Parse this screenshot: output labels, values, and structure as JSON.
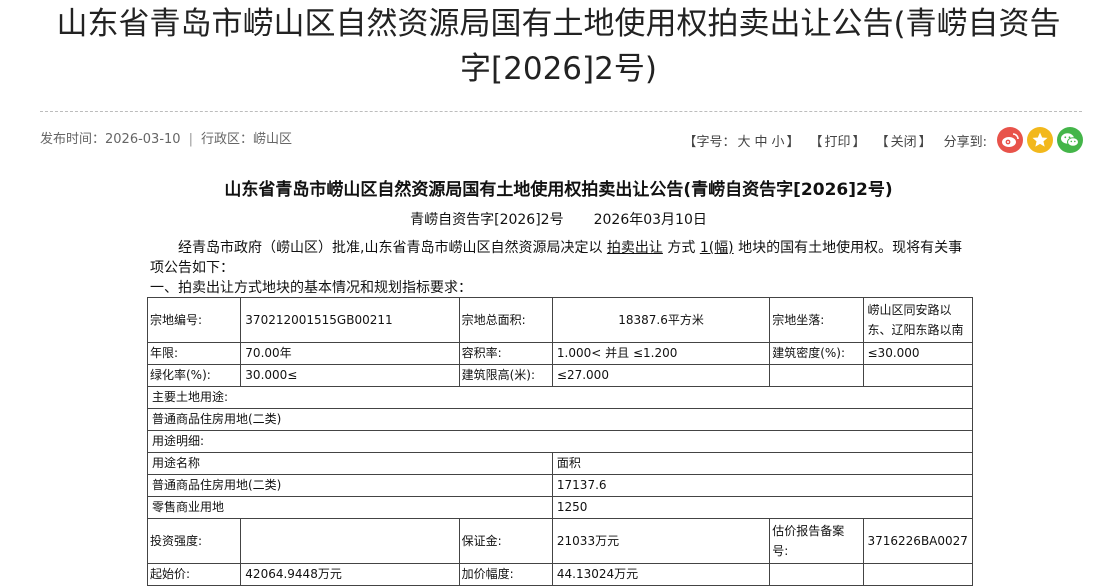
{
  "header": {
    "title_line1": "山东省青岛市崂山区自然资源局国有土地使用权拍卖出让公告(青崂自资告",
    "title_line2": "字[2026]2号)"
  },
  "meta": {
    "publish_label": "发布时间：",
    "publish_date": "2026-03-10",
    "district_label": "行政区：",
    "district": "崂山区"
  },
  "tools": {
    "font_size_label": "字号：",
    "size_large": "大",
    "size_medium": "中",
    "size_small": "小",
    "print": "打印",
    "close": "关闭",
    "share_label": "分享到:",
    "colors": {
      "weibo": "#e8534a",
      "star": "#f2b81c",
      "wechat": "#44b549"
    }
  },
  "document": {
    "title": "山东省青岛市崂山区自然资源局国有土地使用权拍卖出让公告(青崂自资告字[2026]2号)",
    "number": "青崂自资告字[2026]2号",
    "date": "2026年03月10日",
    "para_1": "经青岛市政府（崂山区）批准,山东省青岛市崂山区自然资源局决定以 ",
    "para_method": "拍卖出让",
    "para_2": " 方式 ",
    "para_count": "1(幅)",
    "para_3": " 地块的国有土地使用权。现将有关事项公告如下：",
    "section_1": "一、拍卖出让方式地块的基本情况和规划指标要求："
  },
  "table": {
    "r1": [
      "宗地编号:",
      "370212001515GB00211",
      "宗地总面积:",
      "18387.6平方米",
      "宗地坐落:",
      "崂山区同安路以东、辽阳东路以南"
    ],
    "r2": [
      "年限:",
      "70.00年",
      "容积率:",
      "1.000< 并且 ≤1.200",
      "建筑密度(%):",
      "≤30.000"
    ],
    "r3": [
      "绿化率(%):",
      "30.000≤",
      "建筑限高(米):",
      "≤27.000"
    ],
    "r4": "主要土地用途:",
    "r5": "普通商品住房用地(二类)",
    "r6": "用途明细:",
    "r7": [
      "用途名称",
      "面积"
    ],
    "r8": [
      "普通商品住房用地(二类)",
      "17137.6"
    ],
    "r9": [
      "零售商业用地",
      "1250"
    ],
    "r10": [
      "投资强度:",
      "",
      "保证金:",
      "21033万元",
      "估价报告备案号:",
      "3716226BA0027"
    ],
    "r11": [
      "起始价:",
      "42064.9448万元",
      "加价幅度:",
      "44.13024万元"
    ]
  }
}
